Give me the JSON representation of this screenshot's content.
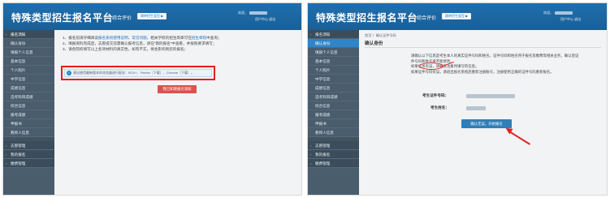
{
  "left": {
    "header": {
      "title": "特殊类型招生报名平台",
      "link": "综合评价",
      "switch_button": "跳转招生类型 ▶",
      "welcome": "欢迎，",
      "user_menu": "用户中心 退出"
    },
    "sidebar": [
      {
        "label": "报名须知",
        "active": true,
        "group": true
      },
      {
        "label": "确认身份"
      },
      {
        "label": "填报个人信息"
      },
      {
        "label": "基本信息"
      },
      {
        "label": "个人照片"
      },
      {
        "label": "中学信息"
      },
      {
        "label": "成绩信息"
      },
      {
        "label": "选考科目成绩"
      },
      {
        "label": "综合信息"
      },
      {
        "label": "报考成绩"
      },
      {
        "label": "申报书"
      },
      {
        "label": "教师人信息"
      },
      {
        "label": "志愿管理",
        "group": true
      },
      {
        "label": "我的报名",
        "group": true
      },
      {
        "label": "缴费管理",
        "group": true
      }
    ],
    "notice": [
      {
        "pre": "1、报名前请仔细阅读",
        "link": "报名系统使用说明",
        "mid": "、",
        "link2": "常见问题",
        "post": "，相关学校的招生简章可在",
        "link3": "招生章程",
        "end": "中查询；"
      },
      {
        "pre": "2、填报资料完成后，志愿提交前需确认报考信息，请在“我的报名”中查看，并按照要求填写；"
      },
      {
        "pre": "3、请各院校填写以上各项材料的真实性，如有不实，将会影响到您的报名；"
      }
    ],
    "info_bar": "建议使用最新版本的浏览器进行报名：IE10+、Firefox（下载）、Chrome（下载）。",
    "red_button": "我已知晓报名须知"
  },
  "right": {
    "header": {
      "title": "特殊类型招生报名平台",
      "link": "综合评价",
      "switch_button": "跳转招生类型 ▶",
      "welcome": "欢迎，",
      "user_menu": "用户中心 退出"
    },
    "sidebar": [
      {
        "label": "报名须知",
        "group": true
      },
      {
        "label": "确认身份",
        "active": true
      },
      {
        "label": "填报个人信息"
      },
      {
        "label": "基本信息"
      },
      {
        "label": "个人照片"
      },
      {
        "label": "中学信息"
      },
      {
        "label": "成绩信息"
      },
      {
        "label": "选考科目成绩"
      },
      {
        "label": "综合信息"
      },
      {
        "label": "报考成绩"
      },
      {
        "label": "申报书"
      },
      {
        "label": "教师人信息"
      },
      {
        "label": "志愿管理",
        "group": true
      },
      {
        "label": "我的报名",
        "group": true
      },
      {
        "label": "缴费管理",
        "group": true
      }
    ],
    "breadcrumb": "首页 〉确认证件号码",
    "page_title": "确认身份",
    "text_lines": [
      "请确认以下信息是考生本人的真实证件号码和姓名。证件号码和姓名用于报名及缴费等相关业务，确认后证",
      "件号码和姓名将不能修改。",
      "如果信息有误，请检查注册时填写的信息。",
      "如果证件号码有误，请退出报名系统后重新注册账号，注册使用正确的证件号码重新报名。"
    ],
    "id_label": "考生证件号码：",
    "name_label": "考生姓名：",
    "confirm_button": "确认无误，开始报名"
  }
}
